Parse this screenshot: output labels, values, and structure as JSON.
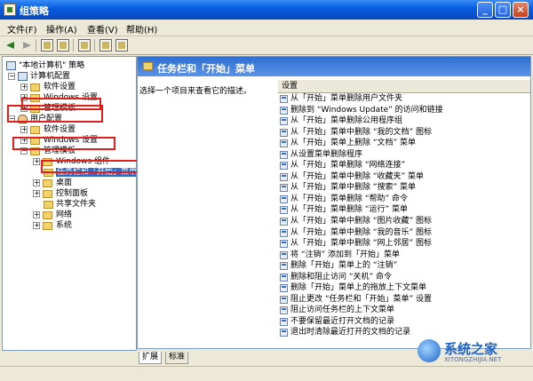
{
  "window": {
    "title": "组策略",
    "minimize": "_",
    "maximize": "□",
    "close": "×"
  },
  "menu": [
    "文件(F)",
    "操作(A)",
    "查看(V)",
    "帮助(H)"
  ],
  "tree": {
    "root": "\"本地计算机\" 策略",
    "computer_config": "计算机配置",
    "computer_children": [
      "软件设置",
      "Windows 设置",
      "管理模板"
    ],
    "user_config": "用户配置",
    "user_children": [
      "软件设置",
      "Windows 设置",
      "管理模板"
    ],
    "admin_children": [
      "Windows 组件",
      "任务栏和「开始」菜单",
      "桌面",
      "控制面板",
      "共享文件夹",
      "网络",
      "系统"
    ],
    "selected": "任务栏和「开始」菜单"
  },
  "right": {
    "header": "任务栏和「开始」菜单",
    "description_prompt": "选择一个项目来查看它的描述。",
    "column_header": "设置",
    "settings": [
      "从「开始」菜单删除用户文件夹",
      "删除到 “Windows Update” 的访问和链接",
      "从「开始」菜单删除公用程序组",
      "从「开始」菜单中删除 “我的文档” 图标",
      "从「开始」菜单上删除 “文档” 菜单",
      "从设置菜单删除程序",
      "从「开始」菜单删除 “网络连接”",
      "从「开始」菜单中删除 “收藏夹” 菜单",
      "从「开始」菜单中删除 “搜索” 菜单",
      "从「开始」菜单删除 “帮助” 命令",
      "从「开始」菜单删除 “运行” 菜单",
      "从「开始」菜单中删除 “图片收藏” 图标",
      "从「开始」菜单中删除 “我的音乐” 图标",
      "从「开始」菜单中删除 “网上邻居” 图标",
      "将 “注销” 添加到「开始」菜单",
      "删除「开始」菜单上的 “注销”",
      "删除和阻止访问 “关机” 命令",
      "删除「开始」菜单上的拖放上下文菜单",
      "阻止更改 “任务栏和「开始」菜单” 设置",
      "阻止访问任务栏的上下文菜单",
      "不要保留最近打开文档的记录",
      "退出时清除最近打开的文档的记录"
    ]
  },
  "tabs": [
    "扩展",
    "标准"
  ],
  "watermark": {
    "name": "系统之家",
    "url": "XITONGZHIJIA.NET"
  }
}
